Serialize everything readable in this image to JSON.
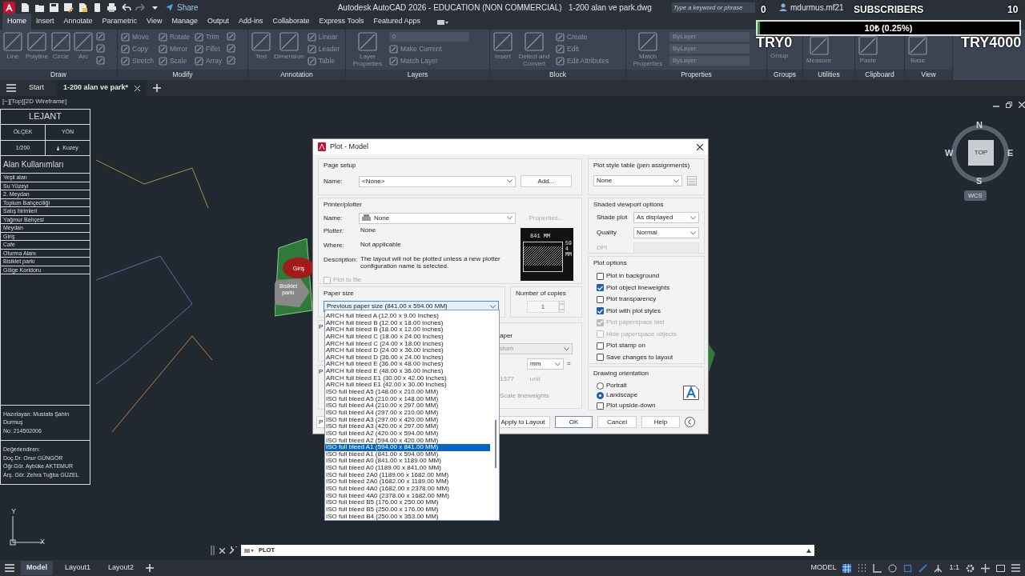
{
  "title_bar": {
    "share": "Share",
    "title": "Autodesk AutoCAD 2026 - EDUCATION (NON COMMERCIAL)",
    "file_name": "1-200 alan ve park.dwg",
    "search": {
      "placeholder": "Type a keyword or phrase"
    },
    "user": "mdurmus.mf21"
  },
  "ribbon": {
    "tabs": [
      {
        "label": "Home",
        "selected": true
      },
      {
        "label": "Insert",
        "selected": false
      },
      {
        "label": "Annotate",
        "selected": false
      },
      {
        "label": "Parametric",
        "selected": false
      },
      {
        "label": "View",
        "selected": false
      },
      {
        "label": "Manage",
        "selected": false
      },
      {
        "label": "Output",
        "selected": false
      },
      {
        "label": "Add-ins",
        "selected": false
      },
      {
        "label": "Collaborate",
        "selected": false
      },
      {
        "label": "Express Tools",
        "selected": false
      },
      {
        "label": "Featured Apps",
        "selected": false
      }
    ],
    "panels": [
      {
        "title": "Draw",
        "tools": [
          {
            "kind": "big",
            "label": "Line"
          },
          {
            "kind": "big",
            "label": "Polyline"
          },
          {
            "kind": "big",
            "label": "Circle"
          },
          {
            "kind": "big",
            "label": "Arc"
          },
          {
            "kind": "icon"
          },
          {
            "kind": "icon"
          },
          {
            "kind": "icon"
          }
        ]
      },
      {
        "title": "Modify",
        "tools": [
          {
            "kind": "small",
            "label": "Move"
          },
          {
            "kind": "small",
            "label": "Copy"
          },
          {
            "kind": "small",
            "label": "Stretch"
          },
          {
            "kind": "small",
            "label": "Rotate"
          },
          {
            "kind": "small",
            "label": "Mirror"
          },
          {
            "kind": "small",
            "label": "Scale"
          },
          {
            "kind": "small",
            "label": "Trim"
          },
          {
            "kind": "small",
            "label": "Fillet"
          },
          {
            "kind": "small",
            "label": "Array"
          },
          {
            "kind": "icon"
          },
          {
            "kind": "icon"
          },
          {
            "kind": "icon"
          }
        ]
      },
      {
        "title": "Annotation",
        "tools": [
          {
            "kind": "big",
            "label": "Text"
          },
          {
            "kind": "big",
            "label": "Dimension"
          },
          {
            "kind": "small",
            "label": "Linear"
          },
          {
            "kind": "small",
            "label": "Leader"
          },
          {
            "kind": "small",
            "label": "Table"
          }
        ]
      },
      {
        "title": "Layers",
        "tools": [
          {
            "kind": "big",
            "label": "Layer Properties"
          },
          {
            "kind": "select",
            "label": "0"
          },
          {
            "kind": "small",
            "label": "Make Current"
          },
          {
            "kind": "small",
            "label": "Match Layer"
          }
        ]
      },
      {
        "title": "Block",
        "tools": [
          {
            "kind": "big",
            "label": "Insert"
          },
          {
            "kind": "big",
            "label": "Detect and Convert"
          },
          {
            "kind": "small",
            "label": "Create"
          },
          {
            "kind": "small",
            "label": "Edit"
          },
          {
            "kind": "small",
            "label": "Edit Attributes"
          }
        ]
      },
      {
        "title": "Properties",
        "tools": [
          {
            "kind": "big",
            "label": "Match Properties"
          },
          {
            "kind": "select",
            "label": "ByLayer"
          },
          {
            "kind": "select",
            "label": "ByLayer"
          },
          {
            "kind": "select",
            "label": "ByLayer"
          }
        ]
      },
      {
        "title": "Groups",
        "tools": [
          {
            "kind": "text",
            "label": "Group"
          }
        ]
      },
      {
        "title": "Utilities",
        "tools": [
          {
            "kind": "big",
            "label": "Measure"
          }
        ]
      },
      {
        "title": "Clipboard",
        "tools": [
          {
            "kind": "big",
            "label": "Paste"
          }
        ]
      },
      {
        "title": "View",
        "tools": [
          {
            "kind": "big",
            "label": "Base"
          }
        ]
      }
    ]
  },
  "file_tabs": [
    {
      "label": "Start",
      "selected": false
    },
    {
      "label": "1-200 alan ve park*",
      "selected": true
    }
  ],
  "viewport_label": "[−][Top][2D Wireframe]",
  "legend": {
    "title": "LEJANT",
    "scale_heading": "ÖLÇEK",
    "direction_heading": "YÖN",
    "scale": "1/200",
    "direction": "Kuzey",
    "uses_title": "Alan Kullanımları",
    "uses": [
      "Yeşil alan",
      "Su Yüzeyi",
      "2. Meydan",
      "Toplum Bahçeciliği",
      "Satış birimleri",
      "Yağmur Bahçesi",
      "Meydan",
      "Giriş",
      "Cafe",
      "Oturma Alanı",
      "Bisiklet parkı",
      "Gölge Koridoru"
    ],
    "prepared_by": "Hazırlayan: Mustafa Şahin Durmuş",
    "student_no": "No: 214502006",
    "reviewers_title": "Değerlendiren:",
    "reviewers": [
      "Doç.Dr. Onur GÜNGÖR",
      "Öğr.Gör. Aybüke AKTEMUR",
      "Arş. Gör. Zehra Tuğba GÜZEL"
    ]
  },
  "drawing_labels": [
    "Giriş",
    "Bisiklet parkı"
  ],
  "compass": {
    "north": "N",
    "east": "E",
    "south": "S",
    "west": "W",
    "cube": "TOP",
    "ucs": "WCS"
  },
  "ucs_axes": {
    "y": "Y",
    "x": "X"
  },
  "plot_dialog": {
    "title": "Plot - Model",
    "page_setup": {
      "legend": "Page setup",
      "name_label": "Name:",
      "name_value": "<None>",
      "add_button": "Add..."
    },
    "printer": {
      "legend": "Printer/plotter",
      "name_label": "Name:",
      "name_value": "None",
      "properties_button": {
        "label": "Properties...",
        "disabled": true
      },
      "info": [
        {
          "label": "Plotter:",
          "value": "None"
        },
        {
          "label": "Where:",
          "value": "Not applicable"
        },
        {
          "label": "Description:",
          "value": "The layout will not be plotted unless a new plotter configuration name is selected."
        }
      ],
      "plot_to_file": {
        "label": "Plot to file",
        "checked": false,
        "disabled": true
      },
      "preview": {
        "width": "841 MM",
        "height": "594 MM"
      }
    },
    "paper_size": {
      "legend": "Paper size",
      "value": "Previous paper size (841.00 x 594.00 MM)",
      "expanded": true,
      "options": [
        {
          "label": "ARCH full bleed A (12.00 x 9.00 Inches)",
          "selected": false
        },
        {
          "label": "ARCH full bleed B (12.00 x 18.00 Inches)",
          "selected": false
        },
        {
          "label": "ARCH full bleed B (18.00 x 12.00 Inches)",
          "selected": false
        },
        {
          "label": "ARCH full bleed C (18.00 x 24.00 Inches)",
          "selected": false
        },
        {
          "label": "ARCH full bleed C (24.00 x 18.00 Inches)",
          "selected": false
        },
        {
          "label": "ARCH full bleed D (24.00 x 36.00 Inches)",
          "selected": false
        },
        {
          "label": "ARCH full bleed D (36.00 x 24.00 Inches)",
          "selected": false
        },
        {
          "label": "ARCH full bleed E (36.00 x 48.00 Inches)",
          "selected": false
        },
        {
          "label": "ARCH full bleed E (48.00 x 36.00 Inches)",
          "selected": false
        },
        {
          "label": "ARCH full bleed E1 (30.00 x 42.00 Inches)",
          "selected": false
        },
        {
          "label": "ARCH full bleed E1 (42.00 x 30.00 Inches)",
          "selected": false
        },
        {
          "label": "ISO full bleed A5 (148.00 x 210.00 MM)",
          "selected": false
        },
        {
          "label": "ISO full bleed A5 (210.00 x 148.00 MM)",
          "selected": false
        },
        {
          "label": "ISO full bleed A4 (210.00 x 297.00 MM)",
          "selected": false
        },
        {
          "label": "ISO full bleed A4 (297.00 x 210.00 MM)",
          "selected": false
        },
        {
          "label": "ISO full bleed A3 (297.00 x 420.00 MM)",
          "selected": false
        },
        {
          "label": "ISO full bleed A3 (420.00 x 297.00 MM)",
          "selected": false
        },
        {
          "label": "ISO full bleed A2 (420.00 x 594.00 MM)",
          "selected": false
        },
        {
          "label": "ISO full bleed A2 (594.00 x 420.00 MM)",
          "selected": false
        },
        {
          "label": "ISO full bleed A1 (594.00 x 841.00 MM)",
          "selected": true
        },
        {
          "label": "ISO full bleed A1 (841.00 x 594.00 MM)",
          "selected": false
        },
        {
          "label": "ISO full bleed A0 (841.00 x 1189.00 MM)",
          "selected": false
        },
        {
          "label": "ISO full bleed A0 (1189.00 x 841.00 MM)",
          "selected": false
        },
        {
          "label": "ISO full bleed 2A0 (1189.00 x 1682.00 MM)",
          "selected": false
        },
        {
          "label": "ISO full bleed 2A0 (1682.00 x 1189.00 MM)",
          "selected": false
        },
        {
          "label": "ISO full bleed 4A0 (1682.00 x 2378.00 MM)",
          "selected": false
        },
        {
          "label": "ISO full bleed 4A0 (2378.00 x 1682.00 MM)",
          "selected": false
        },
        {
          "label": "ISO full bleed B5 (176.00 x 250.00 MM)",
          "selected": false
        },
        {
          "label": "ISO full bleed B5 (250.00 x 176.00 MM)",
          "selected": false
        },
        {
          "label": "ISO full bleed B4 (250.00 x 353.00 MM)",
          "selected": false
        }
      ]
    },
    "copies": {
      "legend": "Number of copies",
      "value": "1"
    },
    "covered": {
      "plot_area_legend": "P",
      "plot_offset_legend": "P",
      "scale_legend": "aper",
      "scale_select": "stom",
      "unit_select": "mm",
      "equals": "=",
      "scale_value": "1377",
      "unit_label": "unit",
      "scale_lineweights": "Scale lineweights",
      "preview_button": "P"
    },
    "plot_style": {
      "legend": "Plot style table (pen assignments)",
      "value": "None"
    },
    "shaded": {
      "legend": "Shaded viewport options",
      "rows": [
        {
          "label": "Shade plot",
          "value": "As displayed",
          "disabled": false
        },
        {
          "label": "Quality",
          "value": "Normal",
          "disabled": false
        },
        {
          "label": "DPI",
          "disabled": true
        }
      ]
    },
    "plot_options": {
      "legend": "Plot options",
      "options": [
        {
          "label": "Plot in background",
          "checked": false,
          "disabled": false
        },
        {
          "label": "Plot object lineweights",
          "checked": true,
          "disabled": false
        },
        {
          "label": "Plot transparency",
          "checked": false,
          "disabled": false
        },
        {
          "label": "Plot with plot styles",
          "checked": true,
          "disabled": false
        },
        {
          "label": "Plot paperspace last",
          "checked": true,
          "disabled": true
        },
        {
          "label": "Hide paperspace objects",
          "checked": false,
          "disabled": true
        },
        {
          "label": "Plot stamp on",
          "checked": false,
          "disabled": false
        },
        {
          "label": "Save changes to layout",
          "checked": false,
          "disabled": false
        }
      ]
    },
    "orientation": {
      "legend": "Drawing orientation",
      "options": [
        {
          "label": "Portrait",
          "selected": false
        },
        {
          "label": "Landscape",
          "selected": true
        }
      ],
      "upside_down": {
        "label": "Plot upside-down",
        "checked": false
      }
    },
    "buttons": [
      {
        "label": "Apply to Layout",
        "default": false
      },
      {
        "label": "OK",
        "default": true
      },
      {
        "label": "Cancel",
        "default": false
      },
      {
        "label": "Help",
        "default": false
      }
    ]
  },
  "command_line": {
    "text": "PLOT"
  },
  "status_bar": {
    "layout_tabs": [
      {
        "label": "Model",
        "selected": true
      },
      {
        "label": "Layout1",
        "selected": false
      },
      {
        "label": "Layout2",
        "selected": false
      }
    ],
    "space": "MODEL",
    "scale": "1:1"
  },
  "stream_overlay": {
    "goal_start": "0",
    "heading": "SUBSCRIBERS",
    "goal_end": "10",
    "progress_text": "10₺ (0.25%)",
    "level": 0.0025,
    "left_amount": "TRY0",
    "right_amount": "TRY4000"
  }
}
